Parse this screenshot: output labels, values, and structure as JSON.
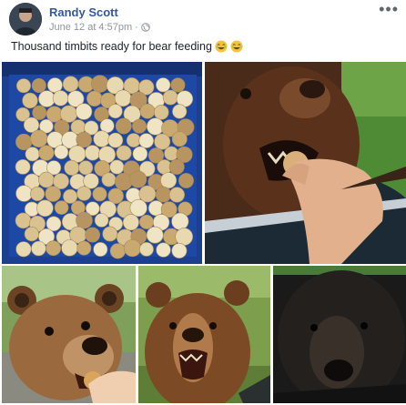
{
  "post": {
    "author": "Randy Scott",
    "date": "June 12 at 4:57pm",
    "separator": "·",
    "privacy_icon": "globe-icon",
    "more_icon": "ellipsis-icon",
    "more_label": "•••",
    "caption": "Thousand timbits ready for bear feeding",
    "caption_emojis": [
      "laughing-face-icon",
      "laughing-face-icon"
    ]
  },
  "photos": [
    {
      "id": "timbits-bin-photo"
    },
    {
      "id": "bear-eating-from-hand-photo"
    },
    {
      "id": "young-bear-closeup-photo"
    },
    {
      "id": "bear-open-mouth-photo"
    },
    {
      "id": "black-bear-face-photo"
    }
  ],
  "colors": {
    "author_link": "#365899",
    "meta_text": "#90949c",
    "body_text": "#1d2129"
  }
}
